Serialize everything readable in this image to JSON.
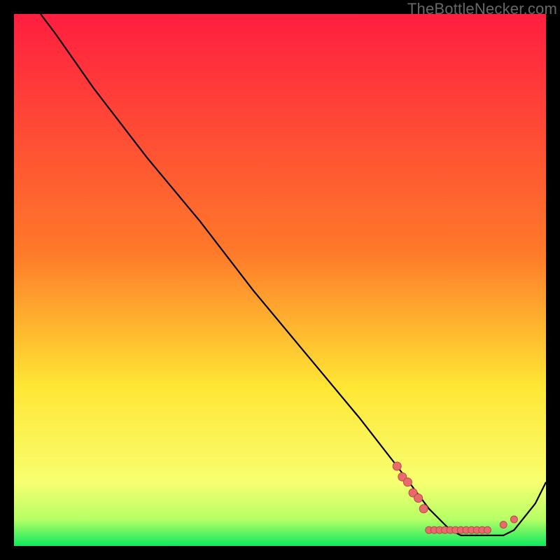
{
  "watermark": "TheBottleNecker.com",
  "chart_data": {
    "type": "line",
    "title": "",
    "xlabel": "",
    "ylabel": "",
    "xlim": [
      0,
      100
    ],
    "ylim": [
      0,
      100
    ],
    "background": {
      "top_color": "#ff1e40",
      "mid_color": "#ffe634",
      "bottom_band_color": "#0ee85f"
    },
    "series": [
      {
        "name": "curve",
        "stroke": "#000000",
        "x": [
          5,
          8,
          15,
          25,
          35,
          45,
          55,
          65,
          72,
          75,
          78,
          80,
          82,
          84,
          86,
          88,
          90,
          92,
          94,
          98,
          100
        ],
        "y": [
          100,
          96,
          86,
          73,
          61,
          48,
          36,
          24,
          15,
          11,
          7,
          5,
          3,
          2,
          2,
          2,
          2,
          2,
          3,
          8,
          12
        ]
      }
    ],
    "marker_clusters": [
      {
        "name": "left-dense",
        "color": "#e86a6a",
        "stroke": "#b94a4a",
        "r": 6,
        "points": [
          {
            "x": 72,
            "y": 15
          },
          {
            "x": 73,
            "y": 13
          },
          {
            "x": 74,
            "y": 12
          },
          {
            "x": 75,
            "y": 10
          },
          {
            "x": 76,
            "y": 9
          },
          {
            "x": 77,
            "y": 7
          }
        ]
      },
      {
        "name": "bottom-dense",
        "color": "#e86a6a",
        "stroke": "#b94a4a",
        "r": 5,
        "points": [
          {
            "x": 78,
            "y": 3
          },
          {
            "x": 79,
            "y": 3
          },
          {
            "x": 80,
            "y": 3
          },
          {
            "x": 81,
            "y": 3
          },
          {
            "x": 82,
            "y": 3
          },
          {
            "x": 83,
            "y": 3
          },
          {
            "x": 84,
            "y": 3
          },
          {
            "x": 85,
            "y": 3
          },
          {
            "x": 86,
            "y": 3
          },
          {
            "x": 87,
            "y": 3
          },
          {
            "x": 88,
            "y": 3
          },
          {
            "x": 89,
            "y": 3
          }
        ]
      },
      {
        "name": "right-sparse",
        "color": "#e86a6a",
        "stroke": "#b94a4a",
        "r": 5,
        "points": [
          {
            "x": 92,
            "y": 4
          },
          {
            "x": 94,
            "y": 5
          }
        ]
      }
    ]
  }
}
